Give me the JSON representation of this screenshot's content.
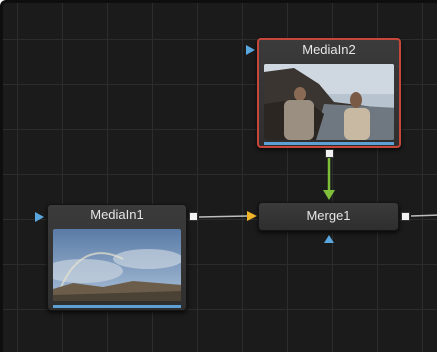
{
  "nodes": {
    "media_in_2": {
      "label": "MediaIn2"
    },
    "media_in_1": {
      "label": "MediaIn1"
    },
    "merge_1": {
      "label": "Merge1"
    }
  },
  "colors": {
    "canvas_background": "#1b1b1b",
    "grid_line": "#2c2c2c",
    "selected_outline": "#c7473b",
    "input_triangle": "#5aa7e0",
    "background_input_triangle": "#f0b429",
    "foreground_wire": "#7fbf3a",
    "wire": "#bdbdbd",
    "status_bar": "#5ca0d6"
  },
  "icons": [
    "input-triangle-icon",
    "output-port-icon",
    "arrow-head-icon"
  ]
}
